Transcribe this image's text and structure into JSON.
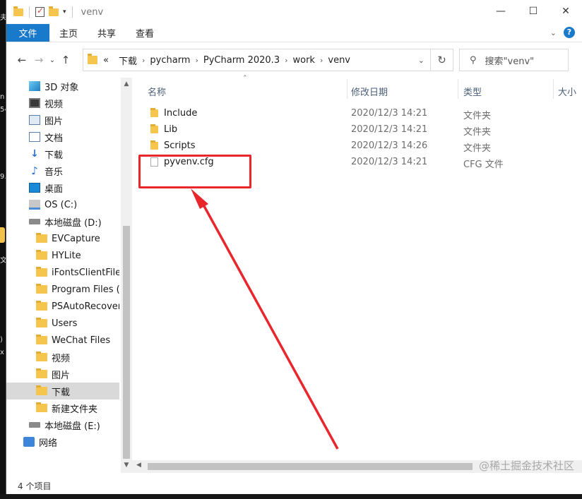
{
  "window": {
    "title": "venv",
    "buttons": {
      "minimize": "—",
      "maximize": "☐",
      "close": "✕"
    }
  },
  "ribbon": {
    "tabs": [
      "文件",
      "主页",
      "共享",
      "查看"
    ],
    "expand_glyph": "⌄",
    "help_glyph": "?"
  },
  "nav": {
    "back": "←",
    "forward": "→",
    "dropdown": "⌄",
    "up": "↑"
  },
  "address": {
    "overflow": "«",
    "segments": [
      "下载",
      "pycharm",
      "PyCharm 2020.3",
      "work",
      "venv"
    ],
    "separator": "›",
    "dropdown": "⌄",
    "refresh": "↻"
  },
  "search": {
    "placeholder": "搜索\"venv\"",
    "icon": "search-icon"
  },
  "sidebar": {
    "items": [
      {
        "label": "3D 对象",
        "icon": "3d-objects-icon",
        "indent": 1
      },
      {
        "label": "视频",
        "icon": "video-icon",
        "indent": 1
      },
      {
        "label": "图片",
        "icon": "pictures-icon",
        "indent": 1
      },
      {
        "label": "文档",
        "icon": "documents-icon",
        "indent": 1
      },
      {
        "label": "下载",
        "icon": "downloads-icon",
        "indent": 1
      },
      {
        "label": "音乐",
        "icon": "music-icon",
        "indent": 1
      },
      {
        "label": "桌面",
        "icon": "desktop-icon",
        "indent": 1
      },
      {
        "label": "OS (C:)",
        "icon": "os-drive-icon",
        "indent": 1
      },
      {
        "label": "本地磁盘 (D:)",
        "icon": "drive-icon",
        "indent": 1
      },
      {
        "label": "EVCapture",
        "icon": "folder-icon",
        "indent": 2
      },
      {
        "label": "HYLite",
        "icon": "folder-icon",
        "indent": 2
      },
      {
        "label": "iFontsClientFileC",
        "icon": "folder-icon",
        "indent": 2
      },
      {
        "label": "Program Files (x",
        "icon": "folder-icon",
        "indent": 2
      },
      {
        "label": "PSAutoRecover",
        "icon": "folder-icon",
        "indent": 2
      },
      {
        "label": "Users",
        "icon": "folder-icon",
        "indent": 2
      },
      {
        "label": "WeChat Files",
        "icon": "folder-icon",
        "indent": 2
      },
      {
        "label": "视频",
        "icon": "folder-icon",
        "indent": 2
      },
      {
        "label": "图片",
        "icon": "folder-icon",
        "indent": 2
      },
      {
        "label": "下载",
        "icon": "folder-icon",
        "indent": 2,
        "selected": true
      },
      {
        "label": "新建文件夹",
        "icon": "folder-icon",
        "indent": 2
      },
      {
        "label": "本地磁盘 (E:)",
        "icon": "drive-icon",
        "indent": 1
      },
      {
        "label": "网络",
        "icon": "network-icon",
        "indent": 0
      }
    ]
  },
  "columns": {
    "name": "名称",
    "modified": "修改日期",
    "type": "类型",
    "size": "大小"
  },
  "files": [
    {
      "name": "Include",
      "modified": "2020/12/3 14:21",
      "type": "文件夹",
      "icon": "folder-icon"
    },
    {
      "name": "Lib",
      "modified": "2020/12/3 14:21",
      "type": "文件夹",
      "icon": "folder-icon"
    },
    {
      "name": "Scripts",
      "modified": "2020/12/3 14:26",
      "type": "文件夹",
      "icon": "folder-icon"
    },
    {
      "name": "pyvenv.cfg",
      "modified": "2020/12/3 14:21",
      "type": "CFG 文件",
      "icon": "file-icon"
    }
  ],
  "status": {
    "count": "4 个项目"
  },
  "watermark": "@稀土掘金技术社区",
  "annotation_color": "#e8262b",
  "accent": "#1979ca",
  "desktop_edge": [
    "夫",
    "n",
    "54",
    "9.",
    "文",
    ")",
    "x"
  ]
}
